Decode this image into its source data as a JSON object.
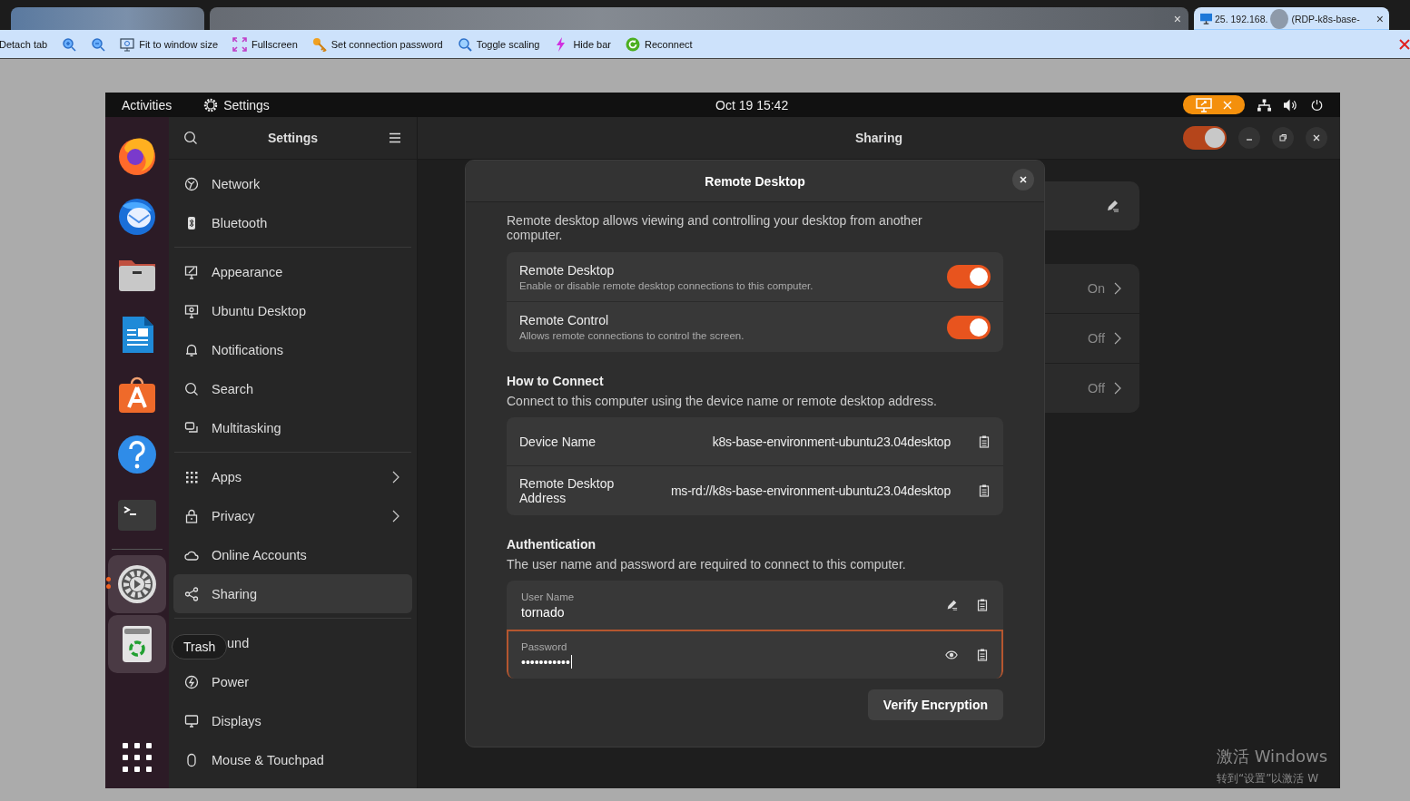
{
  "browser": {
    "tabs": [
      {
        "selected": false
      },
      {
        "selected": false,
        "close": "×"
      },
      {
        "selected": true,
        "title": "25. 192.168.",
        "subtitle": "(RDP-k8s-base-",
        "close": "×"
      }
    ],
    "toolbar": [
      {
        "kind": "text",
        "label": "Detach tab"
      },
      {
        "kind": "icon"
      },
      {
        "kind": "icon"
      },
      {
        "kind": "text",
        "label": "Fit to window size"
      },
      {
        "kind": "text",
        "label": "Fullscreen"
      },
      {
        "kind": "text",
        "label": "Set connection password"
      },
      {
        "kind": "text",
        "label": "Toggle scaling"
      },
      {
        "kind": "text",
        "label": "Hide bar"
      },
      {
        "kind": "text",
        "label": "Reconnect"
      }
    ]
  },
  "top_bar": {
    "activities": "Activities",
    "app": "Settings",
    "clock": "Oct 19  15:42"
  },
  "dock": {
    "apps": [
      {
        "selected": false
      },
      {
        "selected": false
      },
      {
        "selected": false
      },
      {
        "selected": false
      },
      {
        "selected": false
      },
      {
        "selected": false
      },
      {
        "selected": false
      },
      {
        "selected": true
      },
      {
        "selected": false
      }
    ],
    "tooltip": "Trash"
  },
  "sidebar": {
    "title": "Settings",
    "groups": [
      [
        {
          "label": "Network",
          "selected": false
        },
        {
          "label": "Bluetooth",
          "selected": false
        }
      ],
      [
        {
          "label": "Appearance",
          "selected": false
        },
        {
          "label": "Ubuntu Desktop",
          "selected": false
        },
        {
          "label": "Notifications",
          "selected": false
        },
        {
          "label": "Search",
          "selected": false
        },
        {
          "label": "Multitasking",
          "selected": false
        }
      ],
      [
        {
          "label": "Apps",
          "selected": false,
          "submenu": true
        },
        {
          "label": "Privacy",
          "selected": false,
          "submenu": true
        },
        {
          "label": "Online Accounts",
          "selected": false
        },
        {
          "label": "Sharing",
          "selected": true
        }
      ],
      [
        {
          "label": "und",
          "selected": false,
          "kind": "partial"
        },
        {
          "label": "Power",
          "selected": false
        },
        {
          "label": "Displays",
          "selected": false
        },
        {
          "label": "Mouse & Touchpad",
          "selected": false
        }
      ]
    ]
  },
  "main": {
    "title": "Sharing",
    "sharing_on": true,
    "rows": [
      {
        "value": "On"
      },
      {
        "value": "Off"
      },
      {
        "value": "Off"
      }
    ]
  },
  "dialog": {
    "title": "Remote Desktop",
    "description": "Remote desktop allows viewing and controlling your desktop from another computer.",
    "switches": [
      {
        "title": "Remote Desktop",
        "subtitle": "Enable or disable remote desktop connections to this computer.",
        "on": true
      },
      {
        "title": "Remote Control",
        "subtitle": "Allows remote connections to control the screen.",
        "on": true
      }
    ],
    "connect": {
      "heading": "How to Connect",
      "description": "Connect to this computer using the device name or remote desktop address.",
      "rows": [
        {
          "label": "Device Name",
          "value": "k8s-base-environment-ubuntu23.04desktop"
        },
        {
          "label": "Remote Desktop Address",
          "value": "ms-rd://k8s-base-environment-ubuntu23.04desktop"
        }
      ]
    },
    "auth": {
      "heading": "Authentication",
      "description": "The user name and password are required to connect to this computer.",
      "fields": [
        {
          "kind": "text",
          "label": "User Name",
          "value": "tornado",
          "focused": false
        },
        {
          "kind": "password",
          "label": "Password",
          "value": "•••••••••••",
          "focused": true
        }
      ]
    },
    "button": "Verify Encryption"
  },
  "watermark": {
    "title": "激活 Windows",
    "subtitle": "转到“设置”以激活 W"
  }
}
